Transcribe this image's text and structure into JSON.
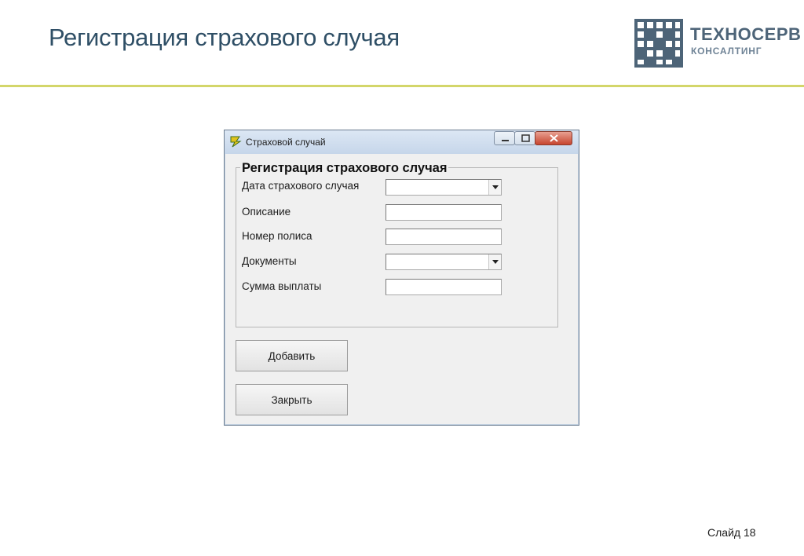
{
  "slide": {
    "title": "Регистрация страхового случая",
    "number_label": "Слайд 18"
  },
  "logo": {
    "name": "ТЕХНОСЕРВ",
    "subtitle": "КОНСАЛТИНГ",
    "colors": {
      "mark": "#4d6478",
      "accent_rule": "#d3d66a"
    }
  },
  "window": {
    "title": "Страховой случай",
    "icon": "app-icon",
    "controls": [
      "minimize-icon",
      "maximize-icon",
      "close-icon"
    ]
  },
  "form": {
    "group_title": "Регистрация страхового случая",
    "fields": [
      {
        "label": "Дата страхового случая",
        "type": "combo",
        "value": ""
      },
      {
        "label": "Описание",
        "type": "text",
        "value": ""
      },
      {
        "label": "Номер полиса",
        "type": "text",
        "value": ""
      },
      {
        "label": "Документы",
        "type": "combo",
        "value": ""
      },
      {
        "label": "Сумма выплаты",
        "type": "text",
        "value": ""
      }
    ],
    "buttons": {
      "add": "Добавить",
      "close": "Закрыть"
    }
  }
}
